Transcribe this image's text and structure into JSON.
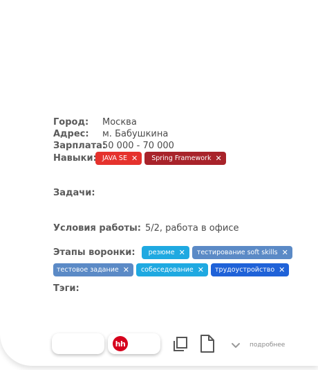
{
  "details": {
    "city_label": "Город:",
    "city_value": "Москва",
    "address_label": "Адрес:",
    "address_value": "м. Бабушкина",
    "salary_label": "Зарплата:",
    "salary_value": "50 000 - 70 000",
    "skills_label": "Навыки:",
    "skills": [
      "JAVA SE",
      "Spring Framework"
    ],
    "tasks_label": "Задачи:",
    "conditions_label": "Условия работы:",
    "conditions_value": "5/2, работа в офисе",
    "funnel_label": "Этапы воронки:",
    "funnel_stages": [
      "резюме",
      "тестирование soft skills",
      "тестовое задание",
      "собеседование",
      "трудоустройство"
    ],
    "tags_label": "Тэги:"
  },
  "toolbar": {
    "hh_logo": "hh",
    "more_label": "подробнее"
  },
  "icons": [
    "close-icon",
    "copy-icon",
    "document-icon",
    "chevron-down-icon"
  ],
  "colors": {
    "skill_tag_1": "#e5322d",
    "skill_tag_2": "#a8232a",
    "stage_cyan": "#1fa9e1",
    "stage_steel": "#5b8ac6",
    "stage_blue": "#1f62d8",
    "hh_brand": "#d6001c"
  }
}
